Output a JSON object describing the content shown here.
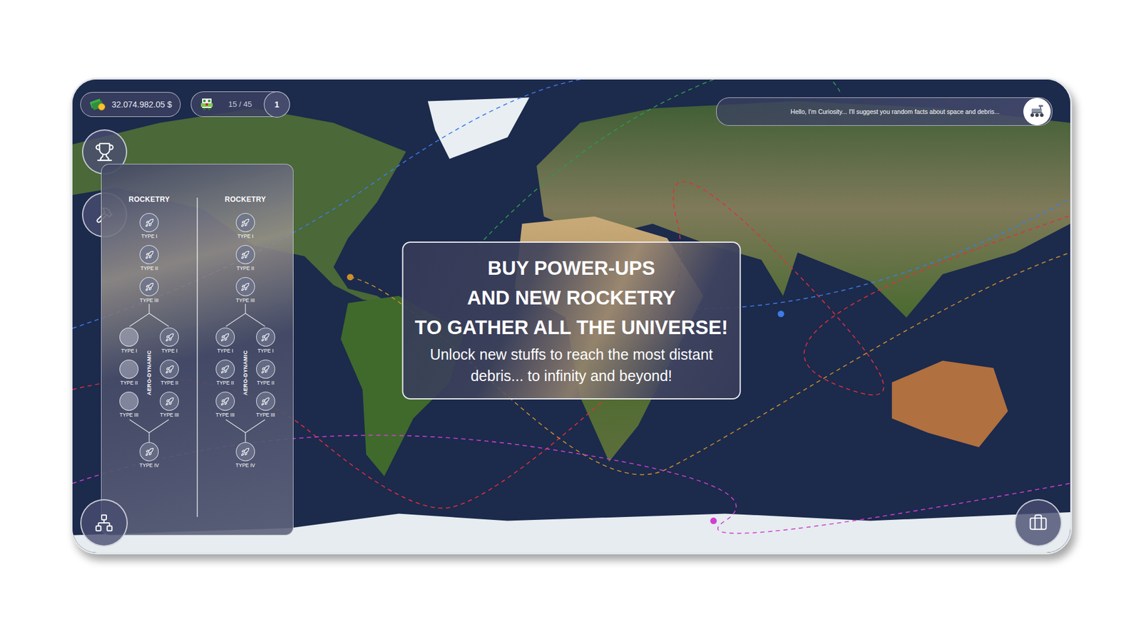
{
  "hud": {
    "money": "32.074.982.05 $",
    "debris": "15 / 45",
    "level": "1"
  },
  "assistant": {
    "message": "Hello, I'm Curiosity... I'll suggest you random facts about space and debris..."
  },
  "skill_trees": [
    {
      "title": "ROCKETRY",
      "base": [
        {
          "label": "TYPE I",
          "unlocked": true
        },
        {
          "label": "TYPE II",
          "unlocked": true
        },
        {
          "label": "TYPE III",
          "unlocked": true
        }
      ],
      "branch_label": "AERO-DYNAMIC",
      "left_branch": [
        {
          "label": "TYPE I",
          "unlocked": false
        },
        {
          "label": "TYPE II",
          "unlocked": false
        },
        {
          "label": "TYPE III",
          "unlocked": false
        }
      ],
      "right_branch": [
        {
          "label": "TYPE I",
          "unlocked": true
        },
        {
          "label": "TYPE II",
          "unlocked": true
        },
        {
          "label": "TYPE III",
          "unlocked": true
        }
      ],
      "final": {
        "label": "TYPE IV",
        "unlocked": true
      }
    },
    {
      "title": "ROCKETRY",
      "base": [
        {
          "label": "TYPE I",
          "unlocked": true
        },
        {
          "label": "TYPE II",
          "unlocked": true
        },
        {
          "label": "TYPE III",
          "unlocked": true
        }
      ],
      "branch_label": "AERO-DYNAMIC",
      "left_branch": [
        {
          "label": "TYPE I",
          "unlocked": true
        },
        {
          "label": "TYPE II",
          "unlocked": true
        },
        {
          "label": "TYPE III",
          "unlocked": true
        }
      ],
      "right_branch": [
        {
          "label": "TYPE I",
          "unlocked": true
        },
        {
          "label": "TYPE II",
          "unlocked": true
        },
        {
          "label": "TYPE III",
          "unlocked": true
        }
      ],
      "final": {
        "label": "TYPE IV",
        "unlocked": true
      }
    }
  ],
  "promo": {
    "title": [
      "BUY POWER-UPS",
      "AND NEW ROCKETRY",
      "TO GATHER ALL THE UNIVERSE!"
    ],
    "subtitle": "Unlock new stuffs to reach the most distant debris... to infinity and beyond!"
  },
  "orbits": [
    {
      "color": "#3d7be8",
      "satellite": true
    },
    {
      "color": "#2f9a4a",
      "satellite": false
    },
    {
      "color": "#e0303a",
      "satellite": false
    },
    {
      "color": "#c8902a",
      "satellite": true
    },
    {
      "color": "#d040d0",
      "satellite": true
    }
  ]
}
